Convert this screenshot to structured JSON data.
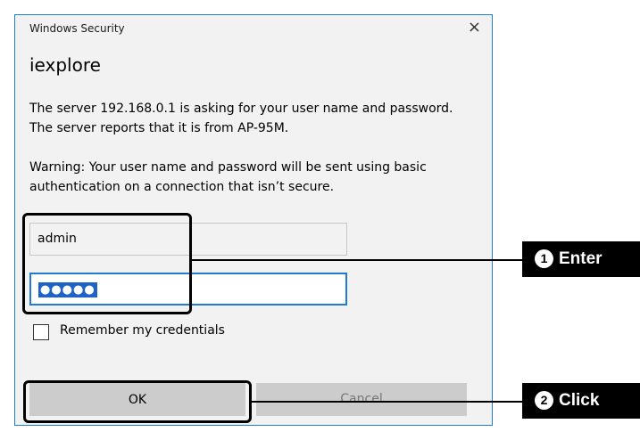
{
  "dialog": {
    "window_title": "Windows Security",
    "heading": "iexplore",
    "message": "The server 192.168.0.1 is asking for your user name and password. The server reports that it is from AP-95M.",
    "warning": "Warning: Your user name and password will be sent using basic authentication on a connection that isn’t secure.",
    "username_value": "admin",
    "password_value": "●●●●●",
    "remember_label": "Remember my credentials",
    "ok_label": "OK",
    "cancel_label": "Cancel",
    "close_glyph": "×",
    "close_icon": "close-icon"
  },
  "annotations": {
    "step1": {
      "number": "1",
      "label": "Enter"
    },
    "step2": {
      "number": "2",
      "label": "Click"
    }
  },
  "colors": {
    "accent": "#1f7bd6",
    "selection": "#1d63c6",
    "dialog_bg": "#f2f2f2",
    "button_bg": "#cccccc",
    "callout_bg": "#000000"
  }
}
